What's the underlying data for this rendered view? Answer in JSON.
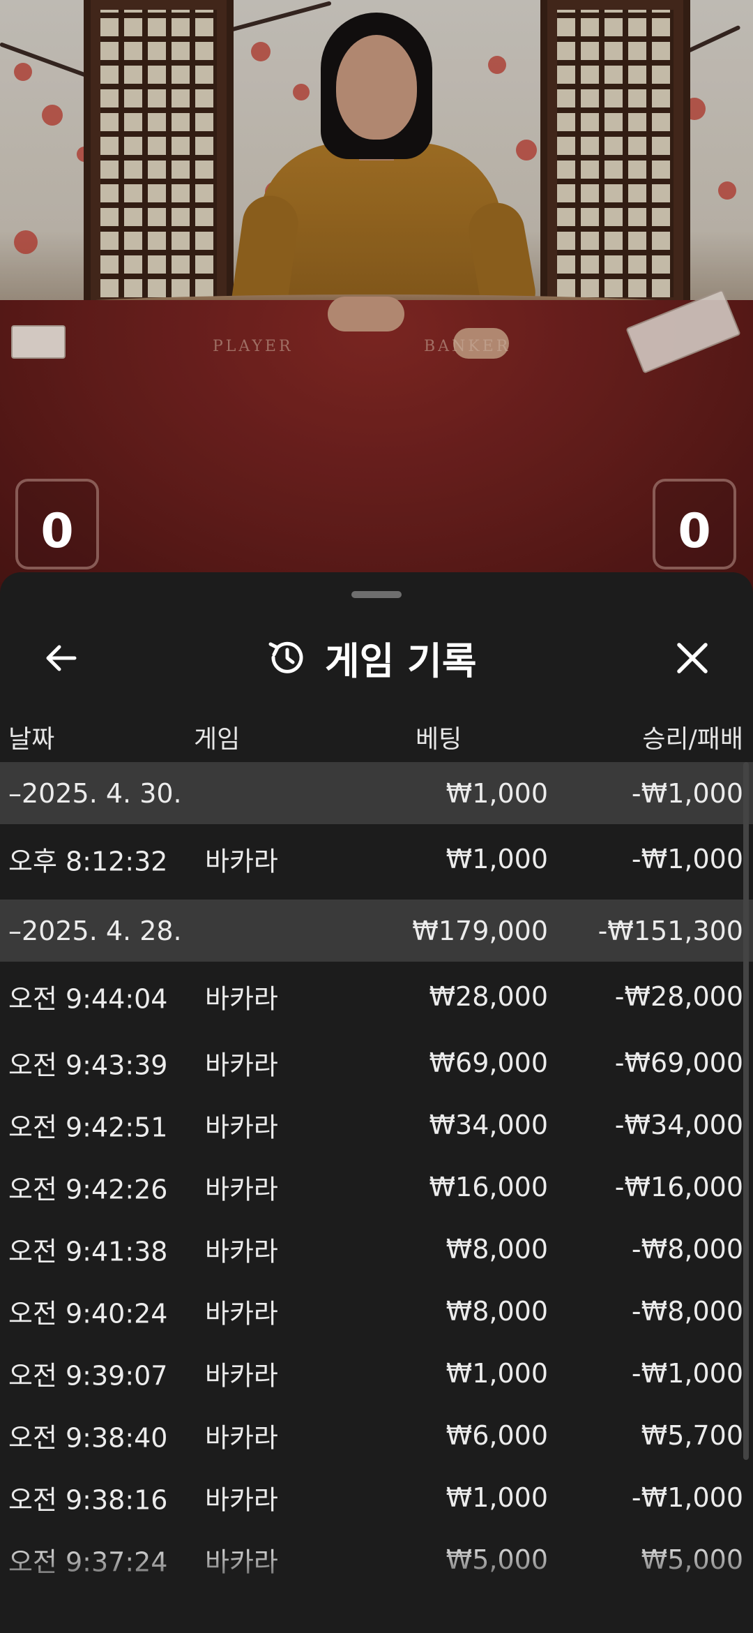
{
  "video": {
    "table_labels": {
      "player": "PLAYER",
      "banker": "BANKER"
    },
    "score_left": "0",
    "score_right": "0"
  },
  "header": {
    "title": "게임 기록",
    "back_icon": "arrow-left-icon",
    "history_icon": "history-icon",
    "close_icon": "close-icon"
  },
  "columns": {
    "date": "날짜",
    "game": "게임",
    "bet": "베팅",
    "win_loss": "승리/패배"
  },
  "groups": [
    {
      "date": "–2025. 4. 30.",
      "bet": "₩1,000",
      "win_loss": "-₩1,000",
      "rows": [
        {
          "time": "오후 8:12:32",
          "game": "바카라",
          "bet": "₩1,000",
          "win_loss": "-₩1,000"
        }
      ]
    },
    {
      "date": "–2025. 4. 28.",
      "bet": "₩179,000",
      "win_loss": "-₩151,300",
      "rows": [
        {
          "time": "오전 9:44:04",
          "game": "바카라",
          "bet": "₩28,000",
          "win_loss": "-₩28,000"
        },
        {
          "time": "오전 9:43:39",
          "game": "바카라",
          "bet": "₩69,000",
          "win_loss": "-₩69,000"
        },
        {
          "time": "오전 9:42:51",
          "game": "바카라",
          "bet": "₩34,000",
          "win_loss": "-₩34,000"
        },
        {
          "time": "오전 9:42:26",
          "game": "바카라",
          "bet": "₩16,000",
          "win_loss": "-₩16,000"
        },
        {
          "time": "오전 9:41:38",
          "game": "바카라",
          "bet": "₩8,000",
          "win_loss": "-₩8,000"
        },
        {
          "time": "오전 9:40:24",
          "game": "바카라",
          "bet": "₩8,000",
          "win_loss": "-₩8,000"
        },
        {
          "time": "오전 9:39:07",
          "game": "바카라",
          "bet": "₩1,000",
          "win_loss": "-₩1,000"
        },
        {
          "time": "오전 9:38:40",
          "game": "바카라",
          "bet": "₩6,000",
          "win_loss": "₩5,700"
        },
        {
          "time": "오전 9:38:16",
          "game": "바카라",
          "bet": "₩1,000",
          "win_loss": "-₩1,000"
        },
        {
          "time": "오전 9:37:24",
          "game": "바카라",
          "bet": "₩5,000",
          "win_loss": "₩5,000"
        }
      ]
    }
  ]
}
